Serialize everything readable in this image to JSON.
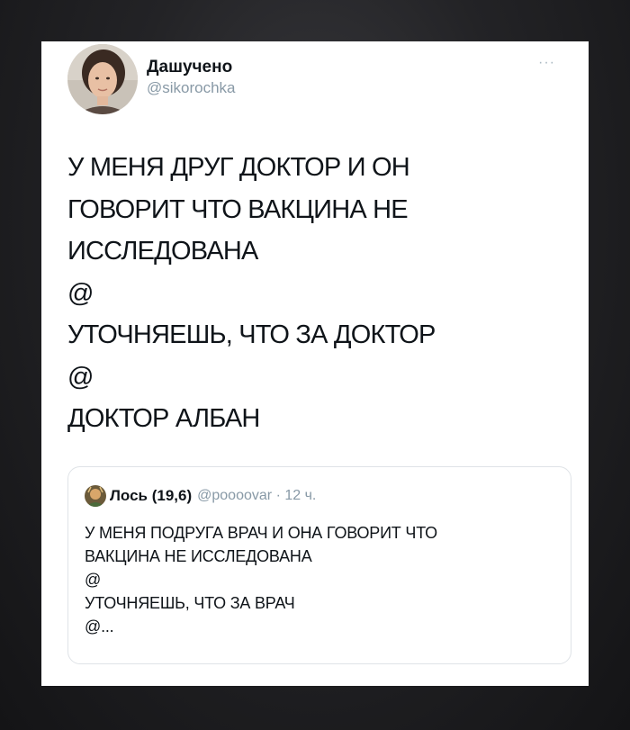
{
  "tweet": {
    "author": {
      "display_name": "Дашучено",
      "handle": "@sikorochka",
      "avatar_icon": "profile-photo"
    },
    "more_icon": "ellipsis-icon",
    "more_glyph": "···",
    "text": "У МЕНЯ ДРУГ ДОКТОР И ОН\nГОВОРИТ ЧТО ВАКЦИНА НЕ\nИССЛЕДОВАНА\n@\nУТОЧНЯЕШЬ, ЧТО ЗА ДОКТОР\n@\nДОКТОР АЛБАН"
  },
  "quoted_tweet": {
    "author": {
      "display_name": "Лось (19,6)",
      "handle": "@poooovar",
      "avatar_icon": "profile-photo"
    },
    "separator": "·",
    "time": "12 ч.",
    "text": "У МЕНЯ ПОДРУГА ВРАЧ И ОНА ГОВОРИТ ЧТО\nВАКЦИНА НЕ ИССЛЕДОВАНА\n@\nУТОЧНЯЕШЬ, ЧТО ЗА ВРАЧ\n@..."
  },
  "colors": {
    "text_primary": "#0f1419",
    "text_secondary": "#8899a6",
    "card_background": "#ffffff",
    "page_background": "#1e1e21"
  }
}
